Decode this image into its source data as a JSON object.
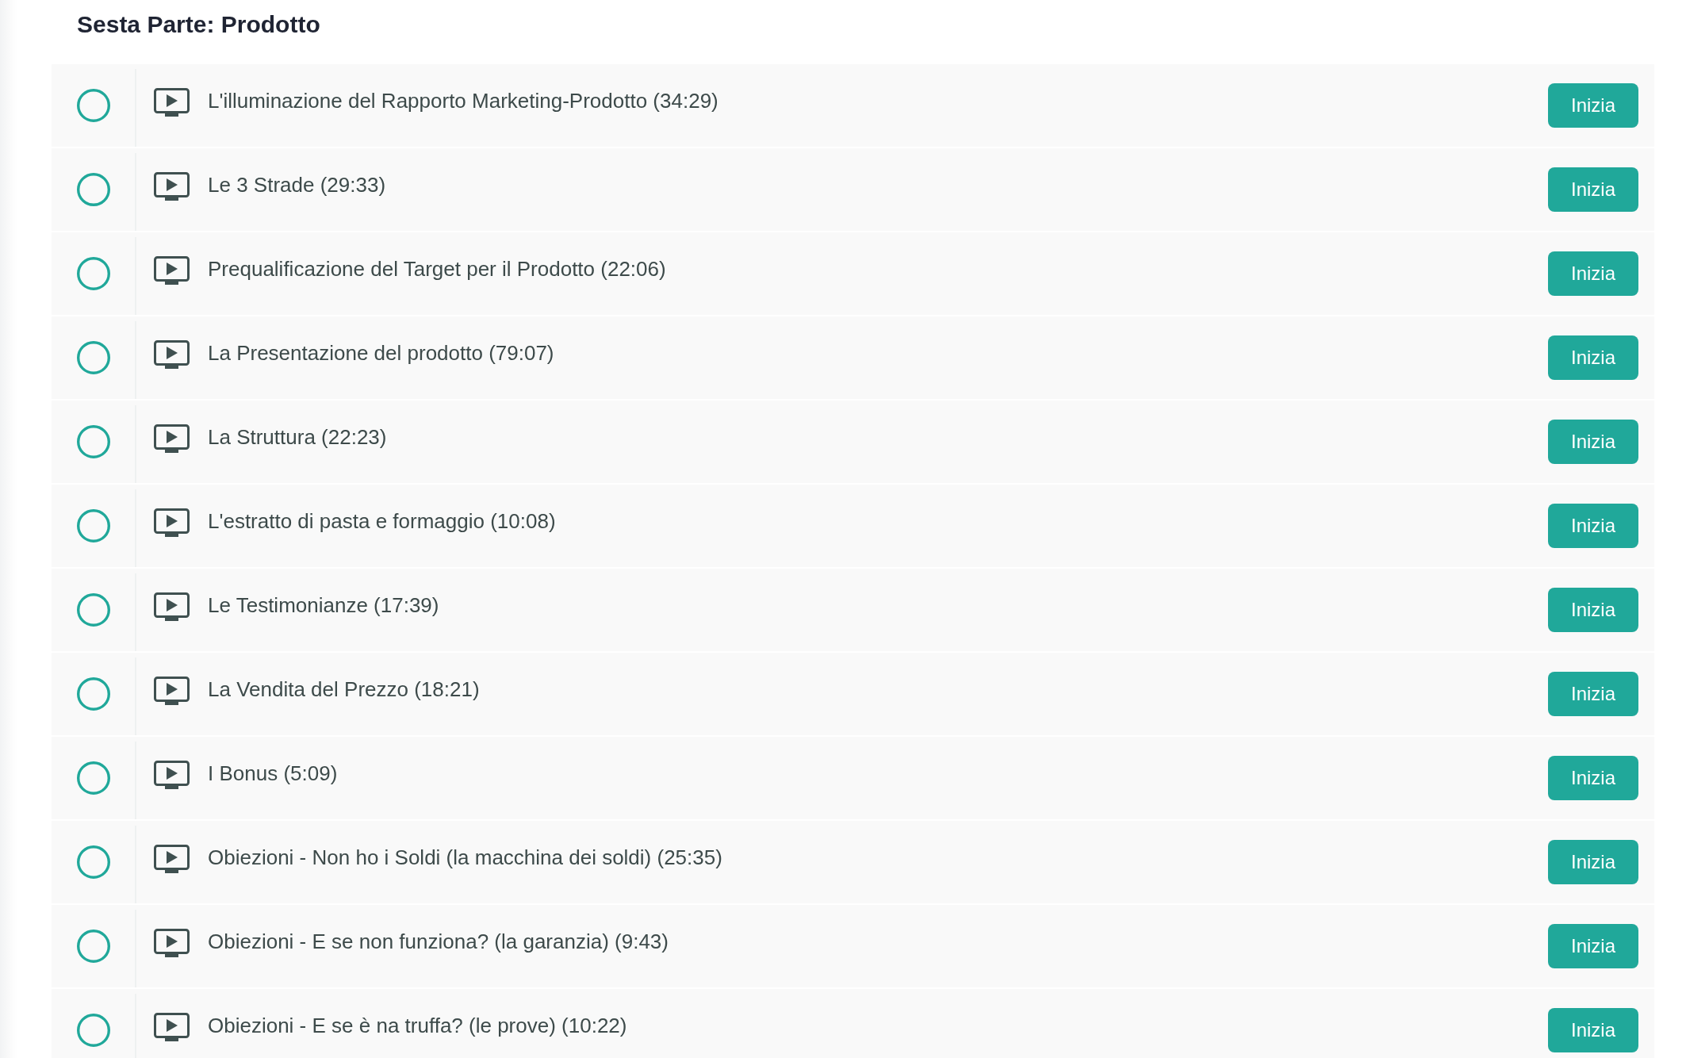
{
  "section": {
    "title": "Sesta Parte: Prodotto"
  },
  "lessons": [
    {
      "title": "L'illuminazione del Rapporto Marketing-Prodotto (34:29)",
      "completed": false,
      "kind": "video",
      "action": "Inizia"
    },
    {
      "title": "Le 3 Strade (29:33)",
      "completed": false,
      "kind": "video",
      "action": "Inizia"
    },
    {
      "title": "Prequalificazione del Target per il Prodotto (22:06)",
      "completed": false,
      "kind": "video",
      "action": "Inizia"
    },
    {
      "title": "La Presentazione del prodotto (79:07)",
      "completed": false,
      "kind": "video",
      "action": "Inizia"
    },
    {
      "title": "La Struttura (22:23)",
      "completed": false,
      "kind": "video",
      "action": "Inizia"
    },
    {
      "title": "L'estratto di pasta e formaggio (10:08)",
      "completed": false,
      "kind": "video",
      "action": "Inizia"
    },
    {
      "title": "Le Testimonianze (17:39)",
      "completed": false,
      "kind": "video",
      "action": "Inizia"
    },
    {
      "title": "La Vendita del Prezzo (18:21)",
      "completed": false,
      "kind": "video",
      "action": "Inizia"
    },
    {
      "title": "I Bonus (5:09)",
      "completed": false,
      "kind": "video",
      "action": "Inizia"
    },
    {
      "title": "Obiezioni - Non ho i Soldi (la macchina dei soldi) (25:35)",
      "completed": false,
      "kind": "video",
      "action": "Inizia"
    },
    {
      "title": "Obiezioni - E se non funziona? (la garanzia) (9:43)",
      "completed": false,
      "kind": "video",
      "action": "Inizia"
    },
    {
      "title": "Obiezioni - E se è na truffa? (le prove) (10:22)",
      "completed": false,
      "kind": "video",
      "action": "Inizia"
    }
  ]
}
